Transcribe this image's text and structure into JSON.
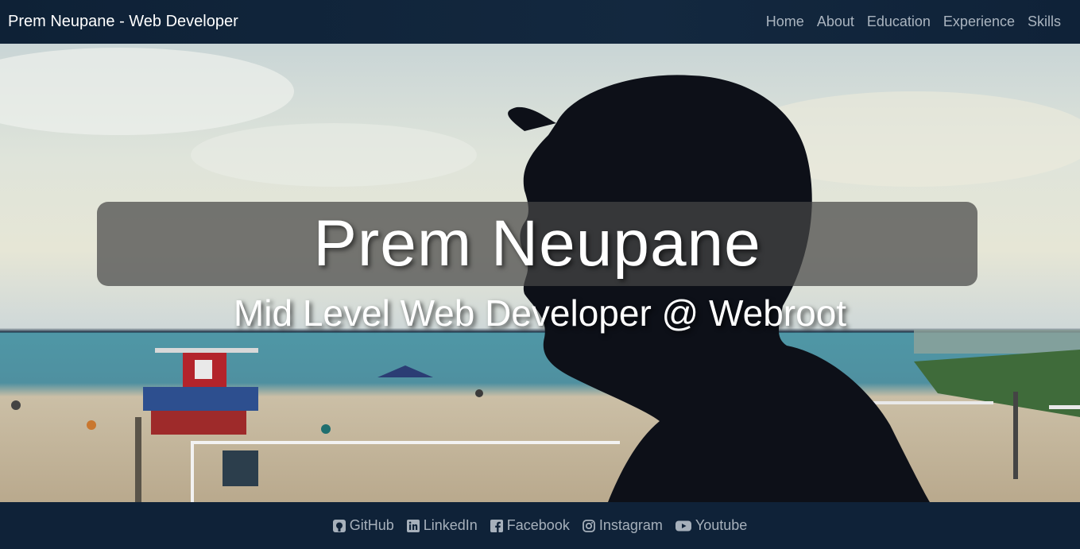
{
  "navbar": {
    "brand": "Prem Neupane - Web Developer",
    "links": [
      {
        "label": "Home"
      },
      {
        "label": "About"
      },
      {
        "label": "Education"
      },
      {
        "label": "Experience"
      },
      {
        "label": "Skills"
      }
    ]
  },
  "hero": {
    "title": "Prem Neupane",
    "subtitle": "Mid Level Web Developer @ Webroot"
  },
  "footer": {
    "links": [
      {
        "label": "GitHub",
        "icon": "github-icon"
      },
      {
        "label": "LinkedIn",
        "icon": "linkedin-icon"
      },
      {
        "label": "Facebook",
        "icon": "facebook-icon"
      },
      {
        "label": "Instagram",
        "icon": "instagram-icon"
      },
      {
        "label": "Youtube",
        "icon": "youtube-icon"
      }
    ]
  },
  "colors": {
    "navbar_bg": "#0f2238",
    "nav_link": "#aab4bf",
    "title_box": "#464646",
    "footer_link": "#a6b0bb"
  }
}
